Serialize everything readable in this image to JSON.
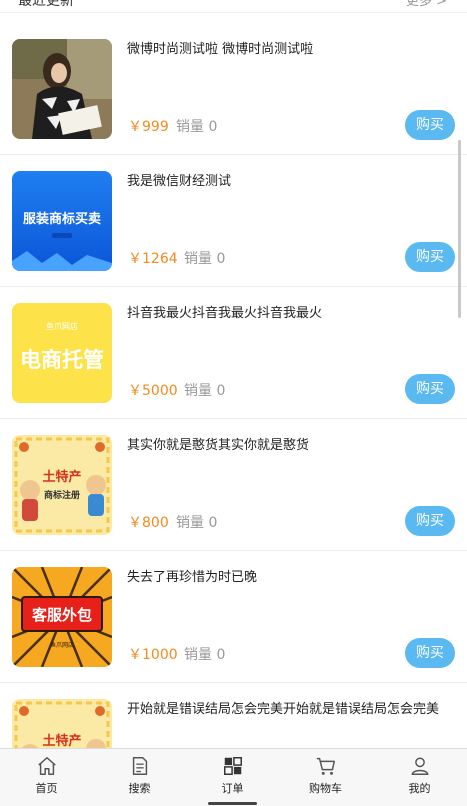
{
  "section": {
    "title": "最近更新",
    "more": "更多 >"
  },
  "buy_label": "购买",
  "sales_label": "销量",
  "products": [
    {
      "title": "微博时尚测试啦 微博时尚测试啦",
      "price": "￥999",
      "sales": "0",
      "image": "woman-reading-photo"
    },
    {
      "title": "我是微信财经测试",
      "price": "￥1264",
      "sales": "0",
      "image": "clothing-trademark-banner",
      "image_text": "服装商标买卖"
    },
    {
      "title": "抖音我最火抖音我最火抖音我最火",
      "price": "￥5000",
      "sales": "0",
      "image": "ecommerce-hosting-banner",
      "image_text": "电商托管",
      "image_small_text": "鱼爪网店"
    },
    {
      "title": "其实你就是憨货其实你就是憨货",
      "price": "￥800",
      "sales": "0",
      "image": "local-specialty-trademark-banner",
      "image_text": "土特产",
      "image_sub_text": "商标注册"
    },
    {
      "title": "失去了再珍惜为时已晚",
      "price": "￥1000",
      "sales": "0",
      "image": "customer-service-outsourcing-banner",
      "image_text": "客服外包",
      "image_small_text": "鱼爪网店"
    },
    {
      "title": "开始就是错误结局怎会完美开始就是错误结局怎会完美",
      "price": "",
      "sales": "",
      "image": "local-specialty-trademark-banner",
      "image_text": "土特产"
    }
  ],
  "tabbar": [
    {
      "label": "首页",
      "icon": "home-icon"
    },
    {
      "label": "搜索",
      "icon": "document-icon"
    },
    {
      "label": "订单",
      "icon": "grid-icon",
      "active": true
    },
    {
      "label": "购物车",
      "icon": "cart-icon"
    },
    {
      "label": "我的",
      "icon": "user-icon"
    }
  ],
  "colors": {
    "price": "#f28a1e",
    "buy_button": "#5bb9f2",
    "sales": "#999999"
  }
}
